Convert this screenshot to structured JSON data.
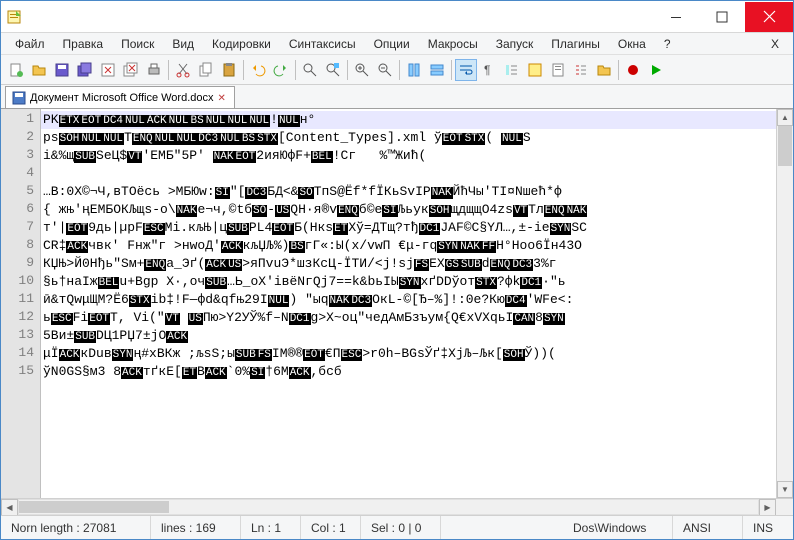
{
  "titlebar": {
    "title": ""
  },
  "menubar": {
    "items": [
      "Файл",
      "Правка",
      "Поиск",
      "Вид",
      "Кодировки",
      "Синтаксисы",
      "Опции",
      "Макросы",
      "Запуск",
      "Плагины",
      "Окна",
      "?",
      "X"
    ]
  },
  "tab": {
    "label": "Документ Microsoft Office Word.docx"
  },
  "editor": {
    "lines": [
      {
        "num": 1,
        "segs": [
          "PK",
          "@ETX",
          "@EOT",
          "@DC4",
          "@NUL",
          "@ACK",
          "@NUL",
          "@BS",
          "@NUL",
          "@NUL",
          "@NUL",
          "!",
          "@NUL",
          "н°"
        ]
      },
      {
        "num": 2,
        "segs": [
          "ps",
          "@SOH",
          "@NUL",
          "@NUL",
          "T",
          "@ENQ",
          "@NUL",
          "@NUL",
          "@DC3",
          "@NUL",
          "@BS",
          "@STX",
          "[Content_Types].xml ў",
          "@EOT",
          "@STX",
          "( ",
          "@NUL",
          "S"
        ]
      },
      {
        "num": 3,
        "segs": [
          "і&%щ",
          "@SUB",
          "SеЦ$",
          "@VT",
          "'EMБ\"5Р' ",
          "@NAK",
          "@EOT",
          "2ияЮфF+",
          "@BEL",
          "!Сг   %™Жић("
        ]
      },
      {
        "num": 4,
        "segs": [
          ""
        ]
      },
      {
        "num": 5,
        "segs": [
          "…В:0X©¬Ч,вТОёсь >МБЮw:",
          "@SI",
          "\"[",
          "@DC3",
          "БД<&",
          "@SO",
          "ТпЅ@Ёf*fЇКьЅvІР",
          "@NAK",
          "ЙћЧы'ТІ¤Nшећ*ф "
        ]
      },
      {
        "num": 6,
        "segs": [
          "{ жњ'ңЕМБОКЉщs-o\\",
          "@NAK",
          "е¬ч,©tб",
          "@SO",
          "-",
          "@US",
          "QH·я®v",
          "@ENQ",
          "б©е",
          "@SI",
          "Љьук",
          "@SOH",
          "щдщщО4zѕ",
          "@VT",
          "Тл",
          "@ENQ",
          "@NAK"
        ]
      },
      {
        "num": 7,
        "segs": [
          "т'|",
          "@EOT",
          "9дь|µрF",
          "@ESC",
          "Мі.кљЊ|ц",
          "@SUB",
          "PL4",
          "@EOT",
          "Б(Нкѕ",
          "@ET",
          "Xў=ДТщ?тђ",
          "@DC1",
          "JAF©C§YЛ…,±-iе",
          "@SYN",
          "SC"
        ]
      },
      {
        "num": 8,
        "segs": [
          "СR‡",
          "@ACK",
          "чвк' Fнж\"г >нwoД'",
          "@ACK",
          "кљЏЉ%)",
          "@BS",
          "гГ«:Ы(x/vwП €μ-гq",
          "@SYN",
          "@NAK",
          "@FF",
          "Н°Ноо6Їн43О"
        ]
      },
      {
        "num": 9,
        "segs": [
          "КЏЊ>Й0Нђь\"Sм+",
          "@ENQ",
          "a_Эґ(",
          "@ACK",
          "@US",
          ">яПvuЭ*шзКсЦ-ЇТИ/<j!sj",
          "@FS",
          "EX",
          "@GS",
          "@SUB",
          "d",
          "@ENQ",
          "@DC3",
          "3%г"
        ]
      },
      {
        "num": 10,
        "segs": [
          "§ь†наІж",
          "@BEL",
          "u+Bgp X·,oч",
          "@SUB",
          "…Ь_oX'iвёNгQj7==k&bьIЫ",
          "@SYN",
          "хґDDўoт",
          "@STX",
          "?фk",
          "@DC1",
          "·\"ь"
        ]
      },
      {
        "num": 11,
        "segs": [
          "ӣ&тQwμЩМ?Ё6",
          "@STX",
          "ib‡!F—фd&qfњ29I",
          "@NUL",
          ") \"ыq",
          "@NAK",
          "@DC3",
          "ОкL-©[Ђ–%]!:0е?Кю",
          "@DC4",
          "'WFе<:"
        ]
      },
      {
        "num": 12,
        "segs": [
          "ь",
          "@ESC",
          "Fi",
          "@EOT",
          "T, Vi(\"",
          "@VT",
          " ",
          "@US",
          "Пю>Y2УЎ%f–N",
          "@DC1",
          "g>X~оц\"чедАмБзъум{Q€xVXqьІ",
          "@CAN",
          "8",
          "@SYN"
        ]
      },
      {
        "num": 13,
        "segs": [
          "5Ви±",
          "@SUB",
          "DЦ1РЏ7±jO",
          "@ACK"
        ]
      },
      {
        "num": 14,
        "segs": [
          "μЇ",
          "@ACK",
          "кDuв",
          "@SYN",
          "ң#xBКж ;љsS;ы",
          "@SUB",
          "@FS",
          "ІM®®",
          "@EOT",
          "€П",
          "@ESC",
          ">r0h–BGѕЎґ‡XjЉ–Љк[",
          "@SOH",
          "Ў))( "
        ]
      },
      {
        "num": 15,
        "segs": [
          "ўN0GS§м3 8",
          "@ACK",
          "тґкЕ[",
          "@ET",
          "B",
          "@ACK",
          "`0%",
          "@SI",
          "†6M",
          "@ACK",
          ",бсб"
        ]
      }
    ]
  },
  "statusbar": {
    "norm_length": "Norn length : 27081",
    "lines": "lines : 169",
    "ln": "Ln : 1",
    "col": "Col : 1",
    "sel": "Sel : 0 | 0",
    "eol": "Dos\\Windows",
    "encoding": "ANSI",
    "mode": "INS"
  }
}
